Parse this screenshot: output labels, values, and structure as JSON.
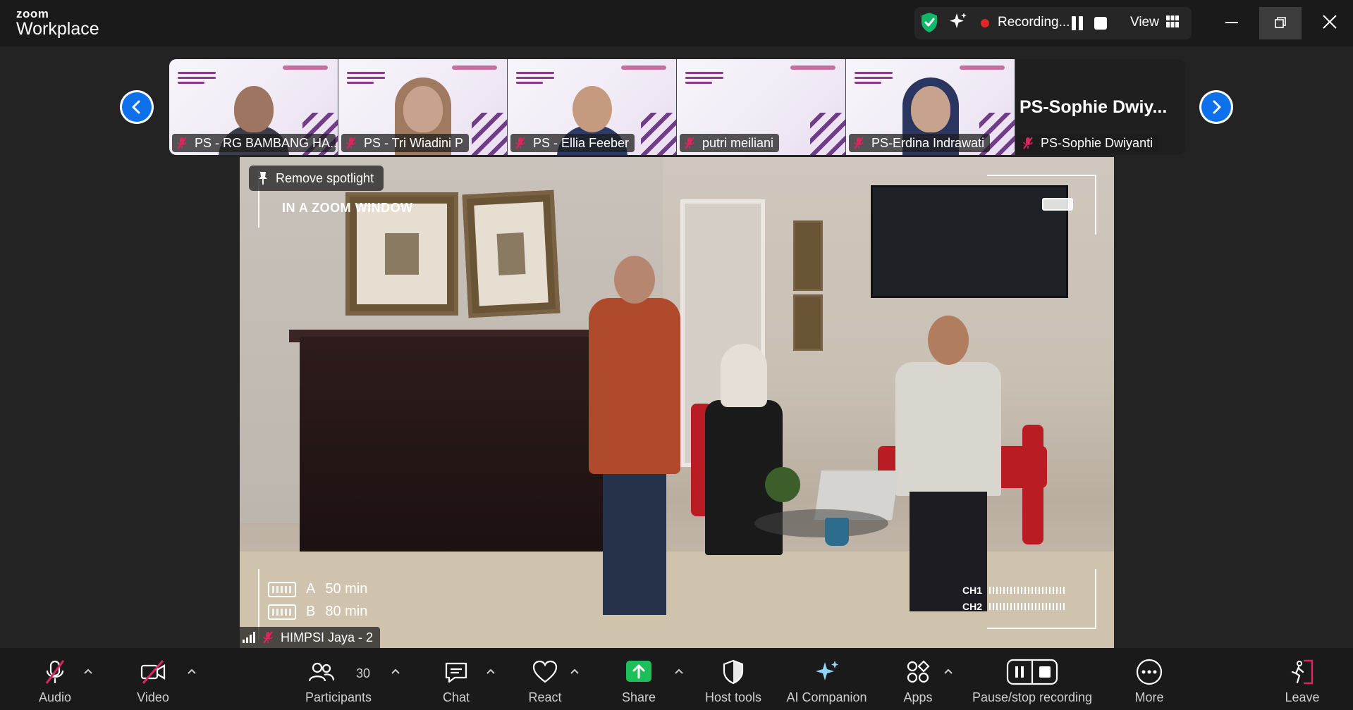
{
  "app": {
    "logo_top": "zoom",
    "logo_bottom": "Workplace"
  },
  "titlebar": {
    "recording_text": "Recording...",
    "view_label": "View",
    "colors": {
      "shield": "#10b86a",
      "recording_dot": "#e02828"
    }
  },
  "thumbnails": [
    {
      "name": "PS - RG BAMBANG HA...",
      "kind": "video"
    },
    {
      "name": "PS - Tri Wiadini P",
      "kind": "video"
    },
    {
      "name": "PS - Ellia Feeber",
      "kind": "video"
    },
    {
      "name": "putri meiliani",
      "kind": "slide"
    },
    {
      "name": "PS-Erdina Indrawati",
      "kind": "video"
    },
    {
      "name": "PS-Sophie Dwiyanti",
      "kind": "name-only",
      "big_name": "PS-Sophie  Dwiy..."
    }
  ],
  "main_video": {
    "spotlight_label": "Remove spotlight",
    "overlay_title": "IN A ZOOM WINDOW",
    "battery_a_label": "A",
    "battery_a_value": "50 min",
    "battery_b_label": "B",
    "battery_b_value": "80 min",
    "ch1": "CH1",
    "ch2": "CH2",
    "participant_name": "HIMPSI Jaya - 2"
  },
  "toolbar": {
    "audio": "Audio",
    "video": "Video",
    "participants": "Participants",
    "participants_count": "30",
    "chat": "Chat",
    "react": "React",
    "share": "Share",
    "host_tools": "Host tools",
    "ai_companion": "AI Companion",
    "apps": "Apps",
    "pause_stop_recording": "Pause/stop recording",
    "more": "More",
    "leave": "Leave",
    "colors": {
      "share_green": "#1dbf5a",
      "muted_red": "#e0245e",
      "leave_red": "#e0245e"
    }
  }
}
